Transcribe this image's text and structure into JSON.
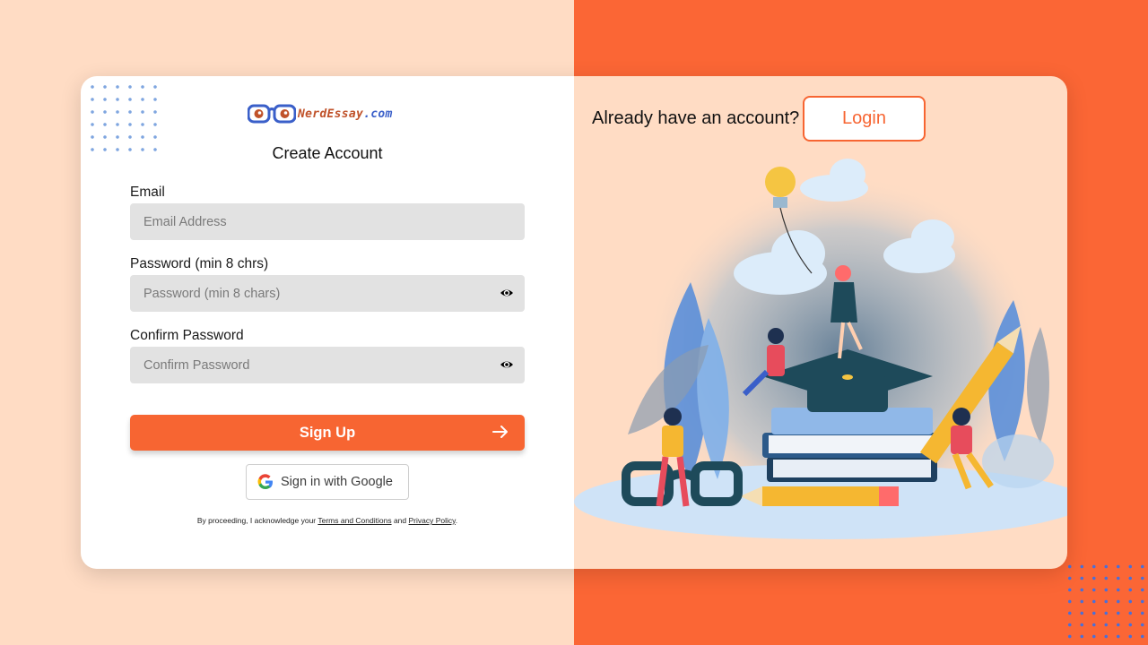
{
  "brand": {
    "logo_main": "NerdEssay",
    "logo_domain": ".com"
  },
  "form": {
    "title": "Create Account",
    "email_label": "Email",
    "email_placeholder": "Email Address",
    "password_label": "Password (min 8 chrs)",
    "password_placeholder": "Password (min 8 chars)",
    "confirm_label": "Confirm Password",
    "confirm_placeholder": "Confirm Password",
    "signup_label": "Sign Up",
    "google_label": "Sign in with Google",
    "legal_prefix": "By proceeding, I acknowledge your",
    "legal_terms": "Terms and Conditions",
    "legal_and": "and",
    "legal_privacy": "Privacy Policy",
    "legal_suffix": "."
  },
  "right": {
    "already_text": "Already have an account?",
    "login_label": "Login"
  },
  "icons": {
    "logo": "glasses-logo-icon",
    "eye": "eye-icon",
    "arrow": "arrow-right-icon",
    "google": "google-g-icon"
  },
  "colors": {
    "accent": "#f76532",
    "bg_left": "#ffdcc4",
    "bg_right": "#fb6635",
    "field_bg": "#e2e2e2"
  }
}
